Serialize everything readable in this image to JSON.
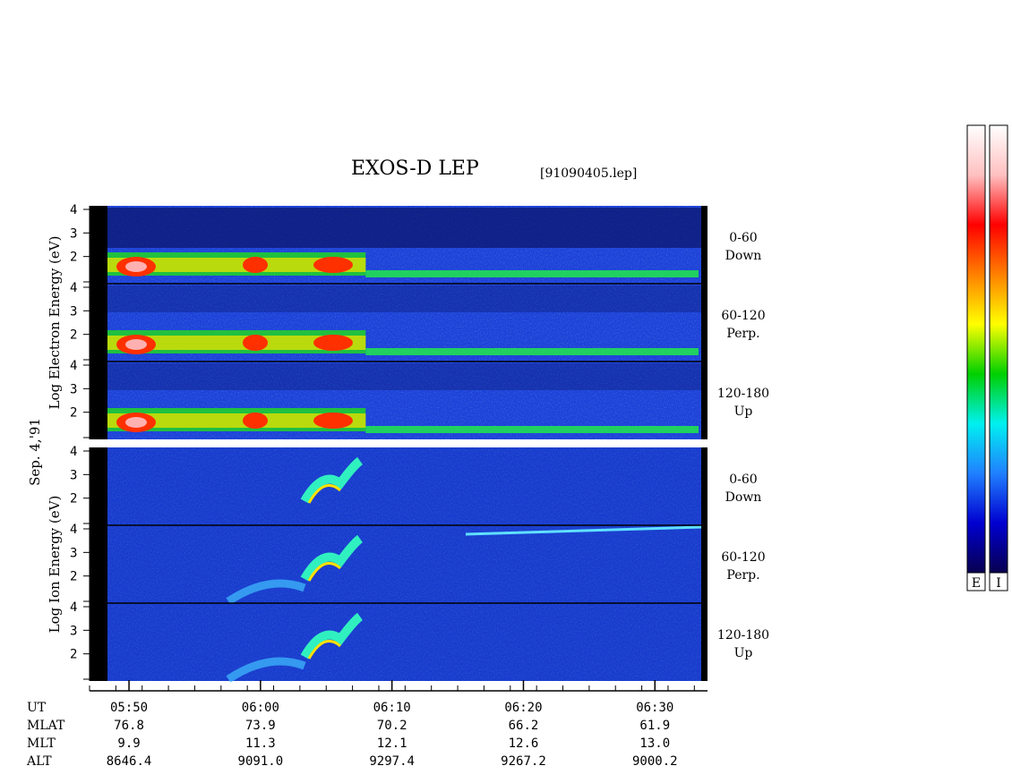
{
  "header": {
    "title": "EXOS-D LEP",
    "file": "[91090405.lep]"
  },
  "date_label": "Sep. 4,'91",
  "chart_data": {
    "type": "heatmap",
    "title": "EXOS-D LEP",
    "x_range": [
      "05:47",
      "06:34"
    ],
    "x_ticks": [
      "05:50",
      "06:00",
      "06:10",
      "06:20",
      "06:30"
    ],
    "groups": [
      {
        "species": "Electron",
        "ylabel": "Log Electron Energy (eV)",
        "ylabel_words": [
          "Log",
          "Electron",
          "Energy (eV)"
        ],
        "ylim": [
          1,
          4
        ],
        "y_ticks": [
          "4",
          "3",
          "2"
        ],
        "panels": [
          {
            "angle": "0-60",
            "direction": "Down"
          },
          {
            "angle": "60-120",
            "direction": "Perp."
          },
          {
            "angle": "120-180",
            "direction": "Up"
          }
        ]
      },
      {
        "species": "Ion",
        "ylabel": "Log Ion Energy (eV)",
        "ylabel_words": [
          "Log",
          "Ion",
          "Energy (eV)"
        ],
        "ylim": [
          1,
          4
        ],
        "y_ticks": [
          "4",
          "3",
          "2"
        ],
        "panels": [
          {
            "angle": "0-60",
            "direction": "Down"
          },
          {
            "angle": "60-120",
            "direction": "Perp."
          },
          {
            "angle": "120-180",
            "direction": "Up"
          }
        ]
      }
    ],
    "orbit_table": {
      "row_labels": [
        "UT",
        "MLAT",
        "MLT",
        "ALT"
      ],
      "columns": [
        {
          "UT": "05:50",
          "MLAT": "76.8",
          "MLT": "9.9",
          "ALT": "8646.4"
        },
        {
          "UT": "06:00",
          "MLAT": "73.9",
          "MLT": "11.3",
          "ALT": "9091.0"
        },
        {
          "UT": "06:10",
          "MLAT": "70.2",
          "MLT": "12.1",
          "ALT": "9297.4"
        },
        {
          "UT": "06:20",
          "MLAT": "66.2",
          "MLT": "12.6",
          "ALT": "9267.2"
        },
        {
          "UT": "06:30",
          "MLAT": "61.9",
          "MLT": "13.0",
          "ALT": "9000.2"
        }
      ]
    },
    "colorbars": [
      {
        "label": "E",
        "colors": [
          "#080050",
          "#0000d0",
          "#2080ff",
          "#00f0f0",
          "#00d000",
          "#ffff00",
          "#ff8000",
          "#ff0000",
          "#ffc0c0",
          "#ffffff"
        ]
      },
      {
        "label": "I",
        "colors": [
          "#080050",
          "#0000d0",
          "#2080ff",
          "#00f0f0",
          "#00d000",
          "#ffff00",
          "#ff8000",
          "#ff0000",
          "#ffc0c0",
          "#ffffff"
        ]
      }
    ]
  }
}
